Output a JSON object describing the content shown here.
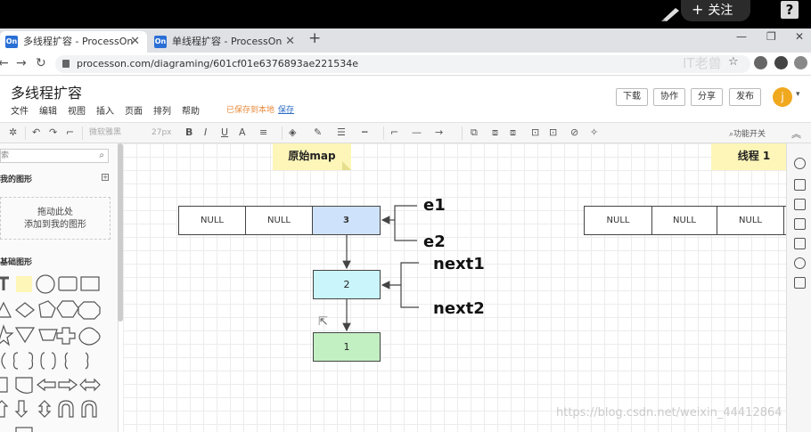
{
  "overlay": {
    "follow_label": "关注",
    "help_label": "?"
  },
  "browser": {
    "tabs": [
      {
        "label": "多线程扩容 - ProcessOn",
        "favicon": "On"
      },
      {
        "label": "单线程扩容 - ProcessOn",
        "favicon": "On"
      }
    ],
    "url": "processon.com/diagraming/601cf01e6376893ae221534e",
    "watermark": "IT老兽"
  },
  "app": {
    "doc_title": "多线程扩容",
    "menu": [
      "文件",
      "编辑",
      "视图",
      "插入",
      "页面",
      "排列",
      "帮助"
    ],
    "save_status": "已保存到本地",
    "save_link": "保存",
    "buttons": {
      "download": "下载",
      "collab": "协作",
      "share": "分享",
      "publish": "发布"
    },
    "avatar_letter": "j"
  },
  "toolbar": {
    "font": "微软雅黑",
    "font_size": "27px",
    "func_toggle": "功能开关"
  },
  "sidebar": {
    "search_placeholder": "索",
    "my_shapes": "我的图形",
    "drop_hint_1": "拖动此处",
    "drop_hint_2": "添加到我的图形",
    "basic_shapes": "基础图形"
  },
  "diagram": {
    "map_note": "原始map",
    "thread_note": "线程 1",
    "left_cells": [
      "NULL",
      "NULL",
      "3"
    ],
    "right_cells": [
      "NULL",
      "NULL",
      "NULL"
    ],
    "node2": "2",
    "node1": "1",
    "e1": "e1",
    "e2": "e2",
    "next1": "next1",
    "next2": "next2",
    "colors": {
      "blue": "#cfe2fb",
      "cyan": "#c9f5fb",
      "green": "#c2f0c2"
    }
  },
  "watermark": "https://blog.csdn.net/weixin_44412864"
}
